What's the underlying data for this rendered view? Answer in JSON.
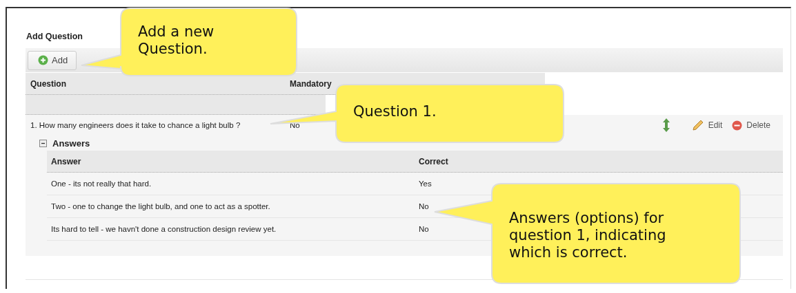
{
  "section_title": "Add Question",
  "toolbar": {
    "add_button": "Add"
  },
  "table": {
    "columns": [
      "Question",
      "Mandatory"
    ],
    "rows": [
      {
        "question": "1. How many engineers does it take to chance a light bulb ?",
        "mandatory": "No",
        "actions": [
          {
            "kind": "move"
          },
          {
            "kind": "edit",
            "label": "Edit"
          },
          {
            "kind": "delete",
            "label": "Delete"
          }
        ],
        "answers": {
          "title": "Answers",
          "expanded": true,
          "columns": [
            "Answer",
            "Correct"
          ],
          "rows": [
            {
              "answer": "One - its not really that hard.",
              "correct": "Yes"
            },
            {
              "answer": "Two - one to change the light bulb, and one to act as a spotter.",
              "correct": "No"
            },
            {
              "answer": "Its hard to tell - we havn't done a construction design review yet.",
              "correct": "No"
            }
          ]
        }
      }
    ]
  },
  "callouts": [
    {
      "text": "Add a new Question."
    },
    {
      "text": "Question 1."
    },
    {
      "text": "Answers (options) for question 1, indicating which is correct."
    }
  ]
}
